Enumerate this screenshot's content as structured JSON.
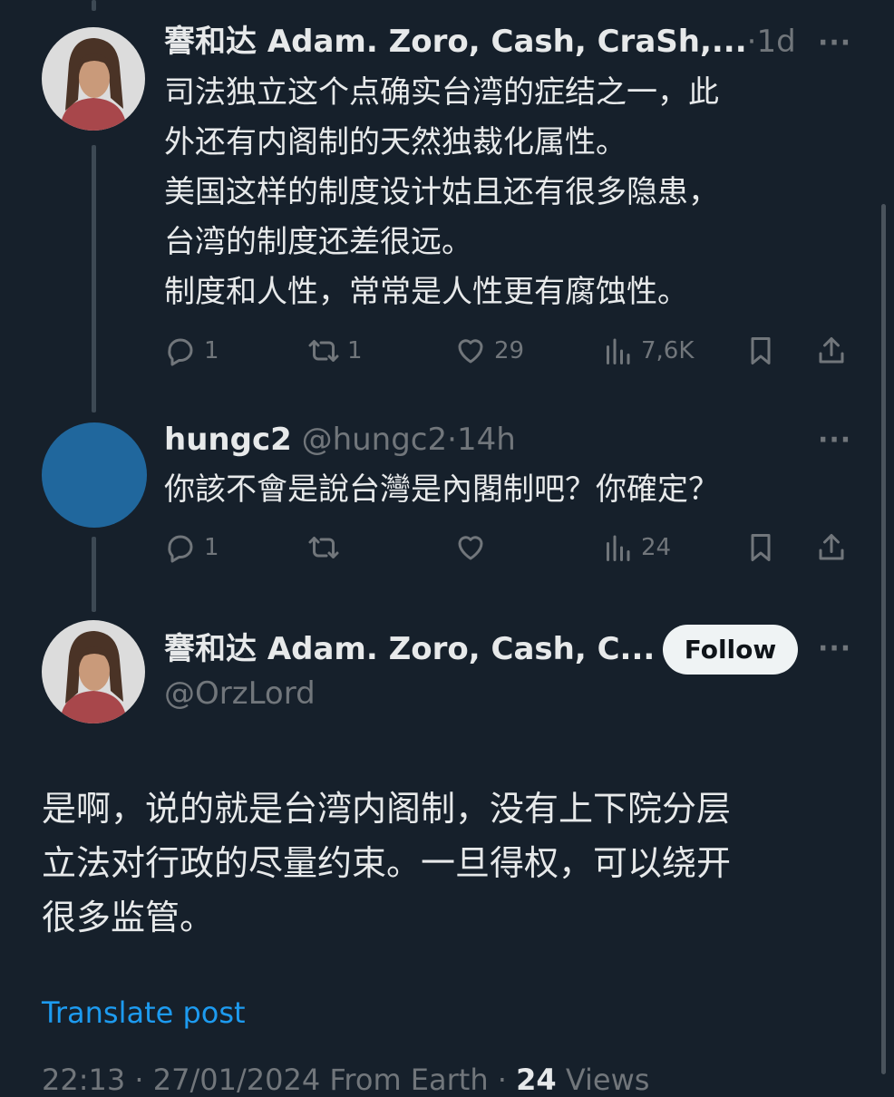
{
  "colors": {
    "background": "#16202b",
    "accent": "#1d9bf0",
    "muted": "#71767b",
    "text": "#e7e9ea"
  },
  "tweet1": {
    "author_name": "謇和达 Adam. Zoro, Cash, CraSh,...",
    "separator": "·",
    "time": "1d",
    "more": "···",
    "lines": [
      "司法独立这个点确实台湾的症结之一，此",
      "外还有内阁制的天然独裁化属性。",
      "美国这样的制度设计姑且还有很多隐患，",
      "台湾的制度还差很远。",
      "制度和人性，常常是人性更有腐蚀性。"
    ],
    "reply_count": "1",
    "retweet_count": "1",
    "like_count": "29",
    "views": "7,6K"
  },
  "tweet2": {
    "author_name": "hungc2",
    "handle": "@hungc2",
    "separator": "·",
    "time": "14h",
    "more": "···",
    "text": "你該不會是說台灣是內閣制吧？你確定？",
    "reply_count": "1",
    "views": "24"
  },
  "main_tweet": {
    "author_name": "謇和达 Adam. Zoro, Cash, C...",
    "handle": "@OrzLord",
    "follow_label": "Follow",
    "more": "···",
    "lines": [
      "是啊，说的就是台湾内阁制，没有上下院分层",
      "立法对行政的尽量约束。一旦得权，可以绕开",
      "很多监管。"
    ],
    "translate_label": "Translate post",
    "meta_datetime": "22:13 · 27/01/2024 From Earth · ",
    "meta_views_count": "24",
    "meta_views_label": " Views"
  }
}
